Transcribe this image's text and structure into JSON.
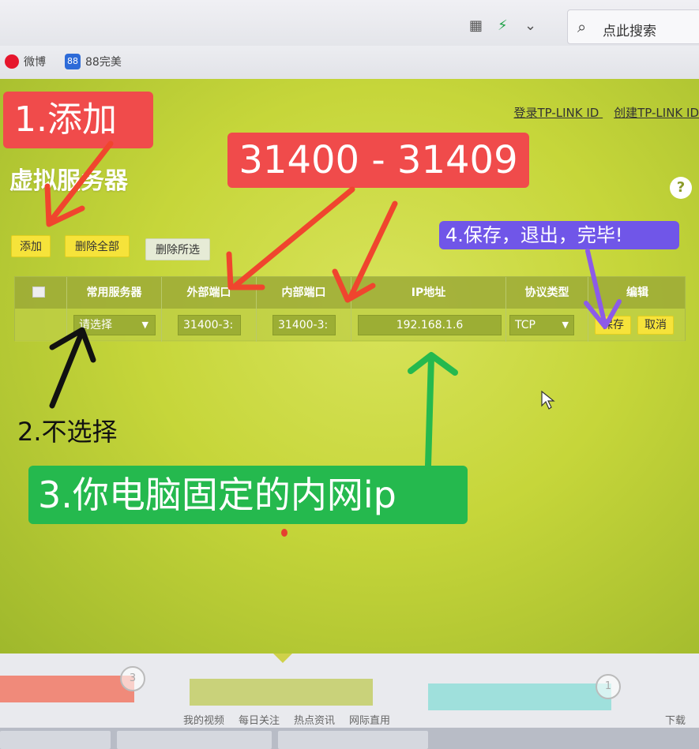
{
  "browser": {
    "search_placeholder": "点此搜索",
    "bookmarks": [
      {
        "label": "微博",
        "icon": "weibo-icon"
      },
      {
        "label": "88完美",
        "icon": "88-icon"
      }
    ]
  },
  "router": {
    "page_title": "虚拟服务器",
    "login_link": "登录TP-LINK ID",
    "create_link": "创建TP-LINK ID",
    "help": "?",
    "buttons": {
      "add": "添加",
      "delete_all": "删除全部",
      "delete_selected": "删除所选"
    },
    "table": {
      "headers": [
        "",
        "常用服务器",
        "外部端口",
        "内部端口",
        "IP地址",
        "协议类型",
        "编辑"
      ],
      "row": {
        "service": "请选择",
        "external_port": "31400-3:",
        "internal_port": "31400-3:",
        "ip": "192.168.1.6",
        "protocol": "TCP",
        "save": "保存",
        "cancel": "取消"
      }
    }
  },
  "annotations": {
    "step1": "1.添加",
    "ports": "31400 - 31409",
    "step2": "2.不选择",
    "step3": "3.你电脑固定的内网ip",
    "step4": "4.保存，退出，完毕!"
  },
  "bottom": {
    "badge_left": "3",
    "badge_right": "1",
    "links": [
      "我的视频",
      "每日关注",
      "热点资讯",
      "网际直用",
      "下载"
    ]
  },
  "colors": {
    "annotation_red": "#f04b4b",
    "annotation_green": "#25b94e",
    "annotation_purple": "#7056e8",
    "page_green": "#c6d63a",
    "button_yellow": "#f6e33a"
  }
}
